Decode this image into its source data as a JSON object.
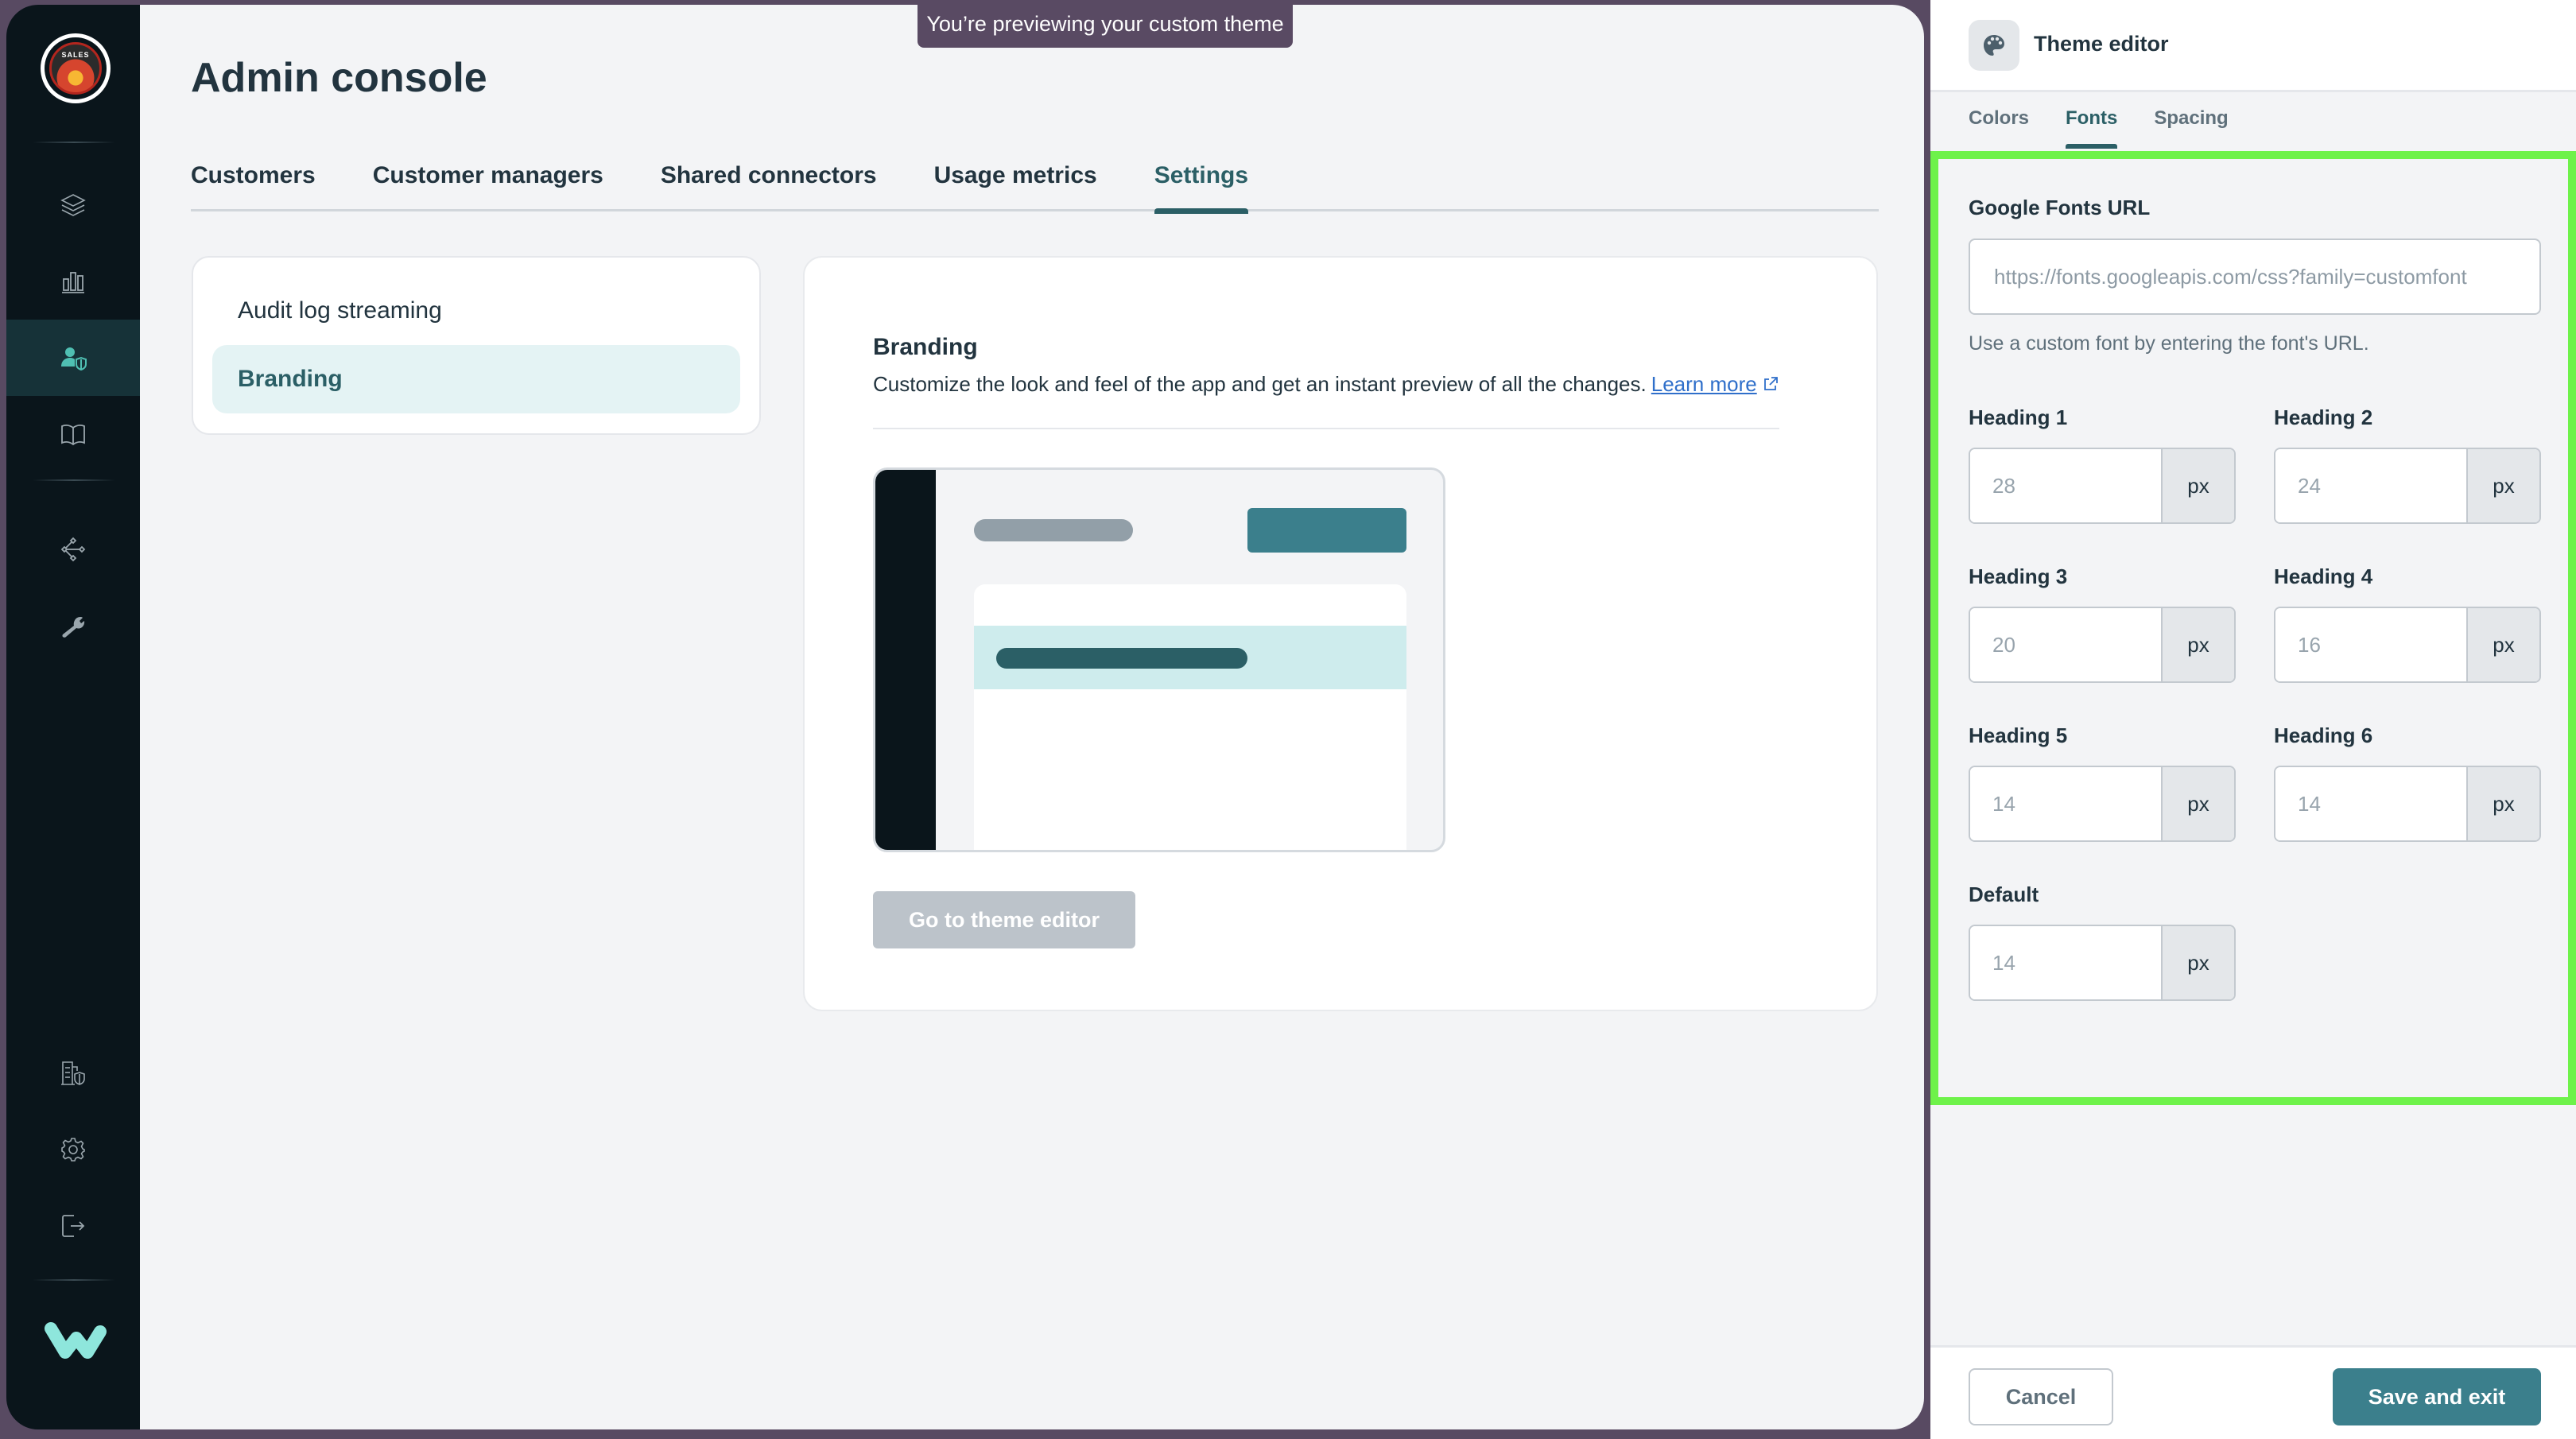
{
  "colors": {
    "frame": "#584a62",
    "nav_bg": "#0a151b",
    "nav_active_bg": "#163238",
    "accent": "#2b5f66",
    "primary_button": "#3b7f8c",
    "highlight_outline": "#6ef24a",
    "link": "#2f6fca",
    "brand_logo": "#8ee6dc"
  },
  "banner": {
    "text": "You’re previewing your custom theme"
  },
  "leftnav": {
    "logo_text": "SALES",
    "top_items": [
      {
        "icon": "layers-icon",
        "label": "Projects",
        "active": false
      },
      {
        "icon": "bar-chart-icon",
        "label": "Insights",
        "active": false
      },
      {
        "icon": "user-shield-icon",
        "label": "Admin console",
        "active": true
      },
      {
        "icon": "book-icon",
        "label": "Docs",
        "active": false
      }
    ],
    "mid_items": [
      {
        "icon": "connector-icon",
        "label": "Connectors"
      },
      {
        "icon": "wrench-icon",
        "label": "Tools"
      }
    ],
    "bottom_items": [
      {
        "icon": "building-shield-icon",
        "label": "Workspace admin"
      },
      {
        "icon": "gear-icon",
        "label": "Settings"
      },
      {
        "icon": "logout-icon",
        "label": "Sign out"
      }
    ],
    "brand_icon": "w-logo-icon"
  },
  "page": {
    "title": "Admin console",
    "tabs": [
      {
        "label": "Customers",
        "active": false
      },
      {
        "label": "Customer managers",
        "active": false
      },
      {
        "label": "Shared connectors",
        "active": false
      },
      {
        "label": "Usage metrics",
        "active": false
      },
      {
        "label": "Settings",
        "active": true
      }
    ]
  },
  "settings_nav": {
    "items": [
      {
        "label": "Audit log streaming",
        "active": false
      },
      {
        "label": "Branding",
        "active": true
      }
    ]
  },
  "branding": {
    "title": "Branding",
    "description": "Customize the look and feel of the app and get an instant preview of all the changes.",
    "learn_more": "Learn more",
    "button_label": "Go to theme editor"
  },
  "theme_editor": {
    "title": "Theme editor",
    "tabs": [
      {
        "label": "Colors",
        "active": false
      },
      {
        "label": "Fonts",
        "active": true
      },
      {
        "label": "Spacing",
        "active": false
      }
    ],
    "google_fonts": {
      "label": "Google Fonts URL",
      "placeholder": "https://fonts.googleapis.com/css?family=customfont",
      "value": "",
      "hint": "Use a custom font by entering the font's URL."
    },
    "sizes": [
      {
        "label": "Heading 1",
        "placeholder": "28",
        "unit": "px"
      },
      {
        "label": "Heading 2",
        "placeholder": "24",
        "unit": "px"
      },
      {
        "label": "Heading 3",
        "placeholder": "20",
        "unit": "px"
      },
      {
        "label": "Heading 4",
        "placeholder": "16",
        "unit": "px"
      },
      {
        "label": "Heading 5",
        "placeholder": "14",
        "unit": "px"
      },
      {
        "label": "Heading 6",
        "placeholder": "14",
        "unit": "px"
      },
      {
        "label": "Default",
        "placeholder": "14",
        "unit": "px"
      }
    ],
    "cancel_label": "Cancel",
    "save_label": "Save and exit"
  }
}
